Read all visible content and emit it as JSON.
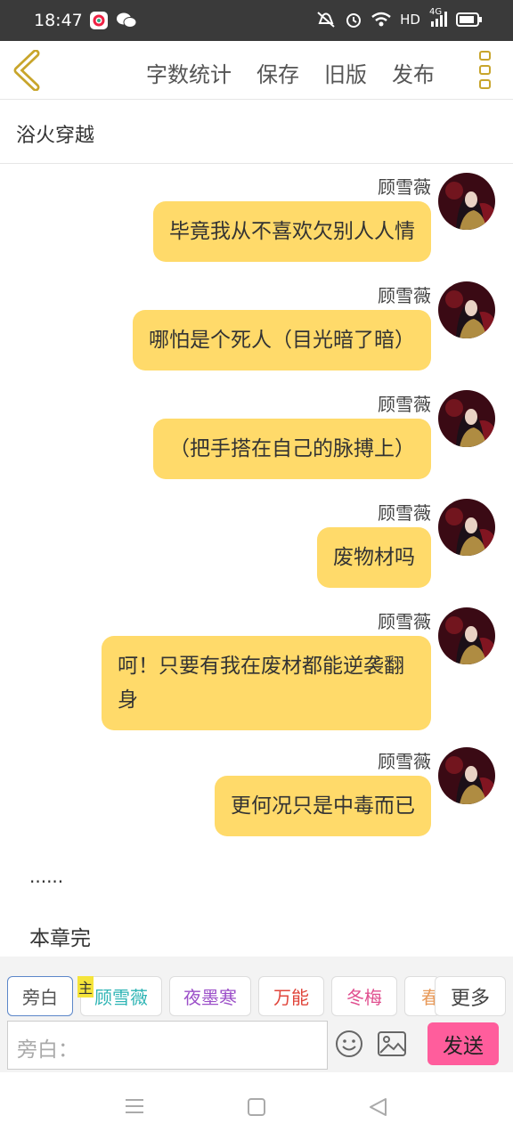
{
  "status": {
    "time": "18:47",
    "hd": "HD",
    "net": "4G"
  },
  "toolbar": {
    "word_count": "字数统计",
    "save": "保存",
    "old_version": "旧版",
    "publish": "发布"
  },
  "chapter_title": "浴火穿越",
  "messages": [
    {
      "name": "顾雪薇",
      "text": "毕竟我从不喜欢欠别人人情"
    },
    {
      "name": "顾雪薇",
      "text": "哪怕是个死人（目光暗了暗）"
    },
    {
      "name": "顾雪薇",
      "text": "（把手搭在自己的脉搏上）"
    },
    {
      "name": "顾雪薇",
      "text": "废物材吗"
    },
    {
      "name": "顾雪薇",
      "text": "呵！只要有我在废材都能逆袭翻身"
    },
    {
      "name": "顾雪薇",
      "text": "更何况只是中毒而已"
    }
  ],
  "ellipsis": "......",
  "end_text": "本章完",
  "roles": [
    {
      "label": "旁白",
      "color": "#555555"
    },
    {
      "label": "顾雪薇",
      "color": "#2fb5b5"
    },
    {
      "label": "夜墨寒",
      "color": "#9b4fc8"
    },
    {
      "label": "万能",
      "color": "#e0453b"
    },
    {
      "label": "冬梅",
      "color": "#e04f8f"
    },
    {
      "label": "春",
      "color": "#e89a5a"
    }
  ],
  "main_badge": "主",
  "more_label": "更多",
  "input_placeholder": "旁白：",
  "send_label": "发送",
  "colors": {
    "bubble": "#ffda6a",
    "send": "#ff5d9c",
    "accent": "#c8a52b"
  }
}
